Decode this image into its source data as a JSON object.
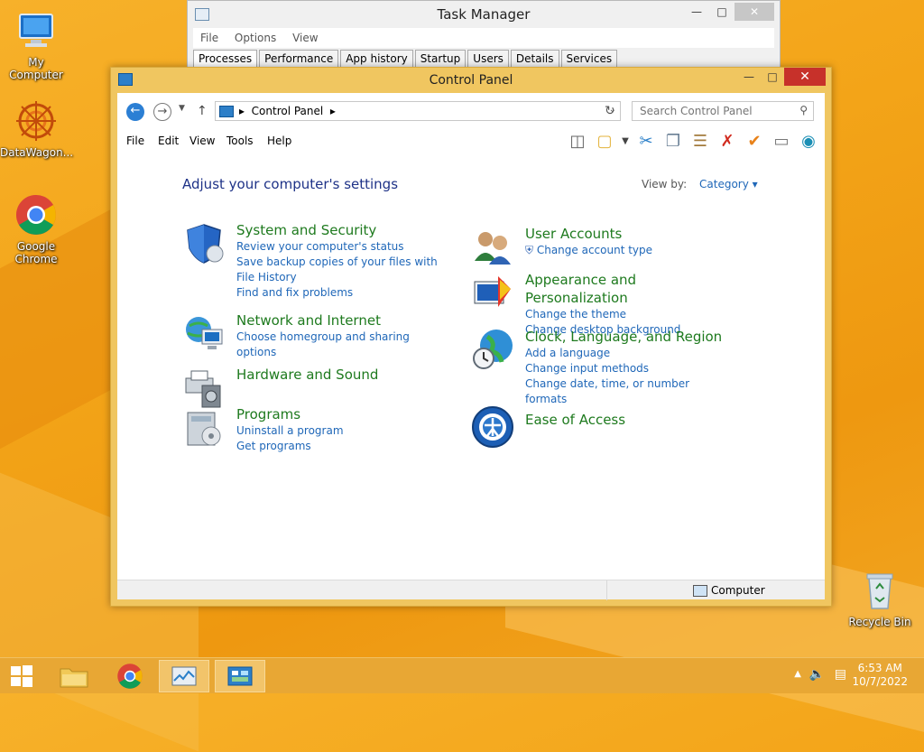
{
  "desktop": {
    "icons": [
      {
        "label": "My Computer"
      },
      {
        "label": "DataWagon..."
      },
      {
        "label": "Google Chrome"
      },
      {
        "label": "Recycle Bin"
      }
    ]
  },
  "task_manager": {
    "title": "Task Manager",
    "menu": [
      "File",
      "Options",
      "View"
    ],
    "tabs": [
      "Processes",
      "Performance",
      "App history",
      "Startup",
      "Users",
      "Details",
      "Services"
    ]
  },
  "control_panel": {
    "title": "Control Panel",
    "address": {
      "crumb": "Control Panel"
    },
    "search": {
      "placeholder": "Search Control Panel"
    },
    "menu": [
      "File",
      "Edit",
      "View",
      "Tools",
      "Help"
    ],
    "heading": "Adjust your computer's settings",
    "view_by": {
      "label": "View by:",
      "value": "Category"
    },
    "categories": [
      {
        "title": "System and Security",
        "links": [
          "Review your computer's status",
          "Save backup copies of your files with File History",
          "Find and fix problems"
        ]
      },
      {
        "title": "Network and Internet",
        "links": [
          "Choose homegroup and sharing options"
        ]
      },
      {
        "title": "Hardware and Sound",
        "links": []
      },
      {
        "title": "Programs",
        "links": [
          "Uninstall a program",
          "Get programs"
        ]
      },
      {
        "title": "User Accounts",
        "links": [
          "Change account type"
        ]
      },
      {
        "title": "Appearance and Personalization",
        "links": [
          "Change the theme",
          "Change desktop background"
        ]
      },
      {
        "title": "Clock, Language, and Region",
        "links": [
          "Add a language",
          "Change input methods",
          "Change date, time, or number formats"
        ]
      },
      {
        "title": "Ease of Access",
        "links": []
      }
    ],
    "status": {
      "location": "Computer"
    }
  },
  "taskbar": {
    "clock": {
      "time": "6:53 AM",
      "date": "10/7/2022"
    }
  }
}
